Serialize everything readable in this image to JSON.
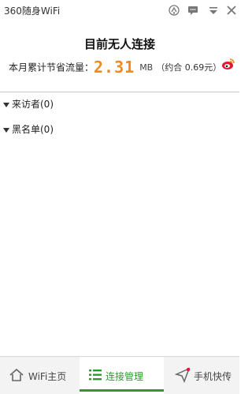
{
  "window": {
    "title": "360随身WiFi"
  },
  "header": {
    "status": "目前无人连接",
    "traffic_label": "本月累计节省流量：",
    "traffic_value": "2.31",
    "traffic_unit": "MB",
    "traffic_cost": "（约合 0.69元）"
  },
  "groups": [
    {
      "label": "来访者(0)"
    },
    {
      "label": "黑名单(0)"
    }
  ],
  "tabs": [
    {
      "label": "WiFi主页",
      "icon": "home-icon"
    },
    {
      "label": "连接管理",
      "icon": "list-icon"
    },
    {
      "label": "手机快传",
      "icon": "send-icon"
    }
  ],
  "colors": {
    "accent": "#2e9a2e",
    "traffic": "#f08a1f",
    "weibo": "#e6162d"
  }
}
